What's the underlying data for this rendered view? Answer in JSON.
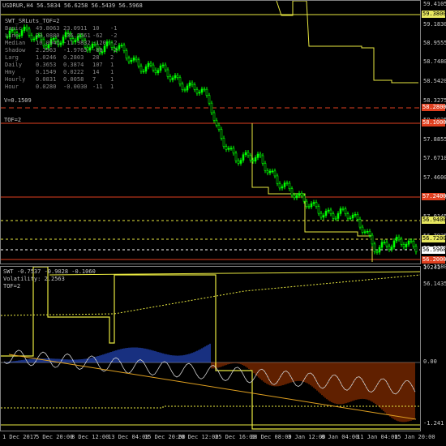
{
  "header": {
    "symbol": "USDRUR,H4",
    "ohlc": "56.5834 56.6258 56.5439 56.5968"
  },
  "indicator": {
    "name": "SWT_SRLuts_TOF=2",
    "rows": [
      {
        "name": "Basic",
        "a": "49.8063",
        "b": "23.0911",
        "c": "10",
        "d": "-1"
      },
      {
        "name": "Line",
        "a": "23.0880",
        "b": "-36.2561",
        "c": "-62",
        "d": "-2"
      },
      {
        "name": "Median",
        "a": "10.0941",
        "b": "-11.9832",
        "c": "-120",
        "d": "-2"
      },
      {
        "name": "Shadow",
        "a": "2.2563",
        "b": "-1.9763",
        "c": "-88",
        "d": "-2"
      },
      {
        "name": "Larg",
        "a": "1.0246",
        "b": "0.2803",
        "c": "28",
        "d": "2"
      },
      {
        "name": "Daily",
        "a": "0.3653",
        "b": "0.3874",
        "c": "107",
        "d": "1"
      },
      {
        "name": "Hmy",
        "a": "0.1549",
        "b": "0.0222",
        "c": "14",
        "d": "1"
      },
      {
        "name": "Hourly",
        "a": "0.0831",
        "b": "0.0058",
        "c": "7",
        "d": "1"
      },
      {
        "name": "Hour",
        "a": "0.0280",
        "b": "-0.0030",
        "c": "-11",
        "d": "1"
      }
    ],
    "v": "V=0.1509",
    "tof": "TOF=2"
  },
  "price_axis": [
    "59.4105",
    "59.1830",
    "58.9555",
    "58.7480",
    "58.5420",
    "58.3275",
    "58.1025",
    "57.8855",
    "57.6710",
    "57.4600",
    "57.2400",
    "57.0145",
    "56.7935",
    "56.5808",
    "56.3580",
    "56.1435"
  ],
  "price_tags": [
    {
      "label": "59.3800",
      "bg": "#e8e860",
      "fg": "#000"
    },
    {
      "label": "58.2800",
      "bg": "#e04020",
      "fg": "#fff"
    },
    {
      "label": "58.1000",
      "bg": "#e04020",
      "fg": "#fff"
    },
    {
      "label": "57.2400",
      "bg": "#e04020",
      "fg": "#fff"
    },
    {
      "label": "56.9400",
      "bg": "#e8e860",
      "fg": "#000"
    },
    {
      "label": "56.7200",
      "bg": "#e8e860",
      "fg": "#000"
    },
    {
      "label": "56.5968",
      "bg": "#ffffff",
      "fg": "#000"
    },
    {
      "label": "56.2000",
      "bg": "#e04020",
      "fg": "#fff"
    }
  ],
  "subwindow": {
    "header": "SWT -0.7537 -0.9028 -0.1060",
    "volatility": "Volatility: 2.2563",
    "tof": "TOF=2",
    "axis": [
      "1.241",
      "0.00",
      "-1.241"
    ]
  },
  "time_axis": [
    "1 Dec 2017",
    "5 Dec 20:00",
    "8 Dec 12:00",
    "13 Dec 04:00",
    "15 Dec 20:00",
    "20 Dec 12:00",
    "25 Dec 16:00",
    "28 Dec 08:00",
    "3 Jan 12:00",
    "8 Jan 04:00",
    "11 Jan 04:00",
    "15 Jan 20:00"
  ],
  "colors": {
    "bull": "#00ff00",
    "bear": "#00ff00",
    "grid": "#404040",
    "yellow": "#e8e840",
    "red": "#e04020"
  }
}
